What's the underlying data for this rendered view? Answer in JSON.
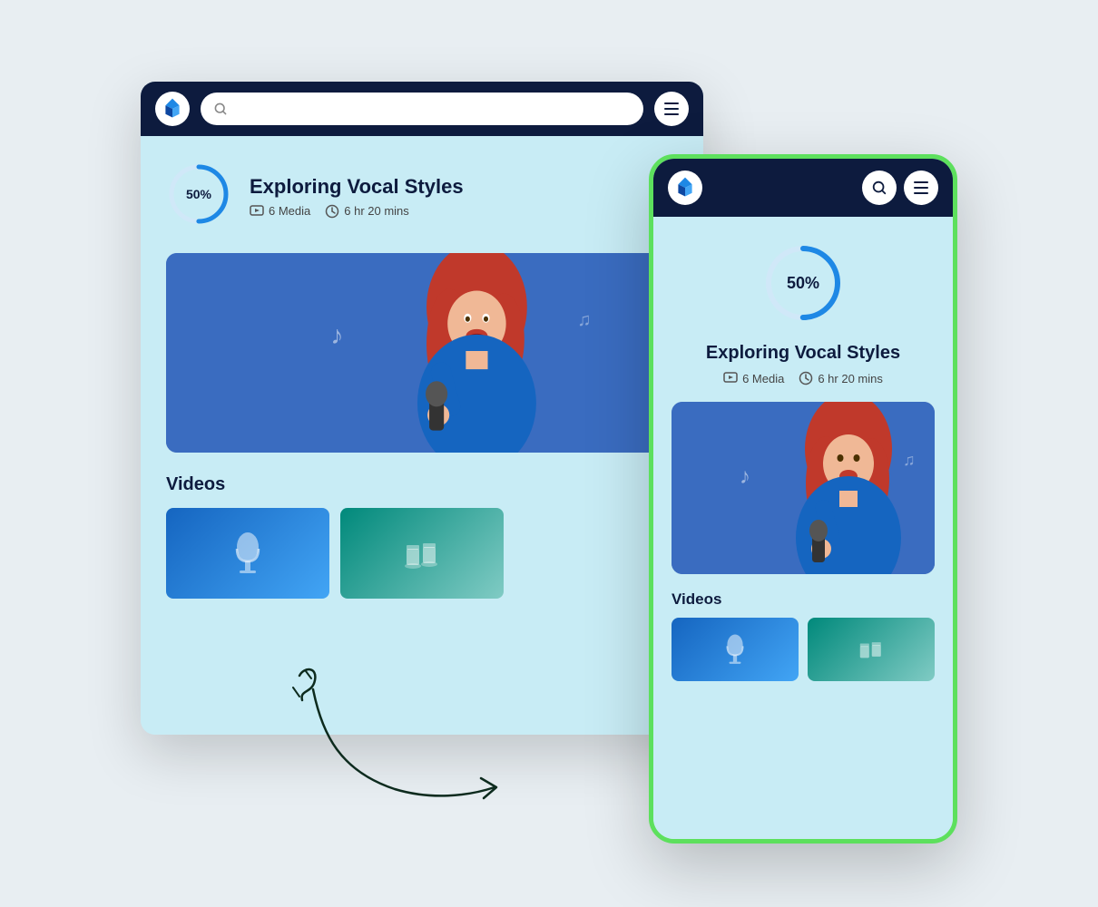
{
  "desktop": {
    "search_placeholder": "",
    "course_title": "Exploring Vocal Styles",
    "progress_percent": "50%",
    "media_count": "6 Media",
    "duration": "6 hr 20 mins",
    "section_title": "Videos",
    "menu_label": "menu"
  },
  "mobile": {
    "course_title": "Exploring Vocal Styles",
    "progress_percent": "50%",
    "media_count": "6 Media",
    "duration": "6 hr 20 mins",
    "section_title": "Videos"
  },
  "colors": {
    "nav_bg": "#0d1b3e",
    "content_bg": "#c8ecf5",
    "page_bg": "#e8eef2",
    "phone_border": "#5de05d",
    "accent_blue": "#1e88e5"
  }
}
